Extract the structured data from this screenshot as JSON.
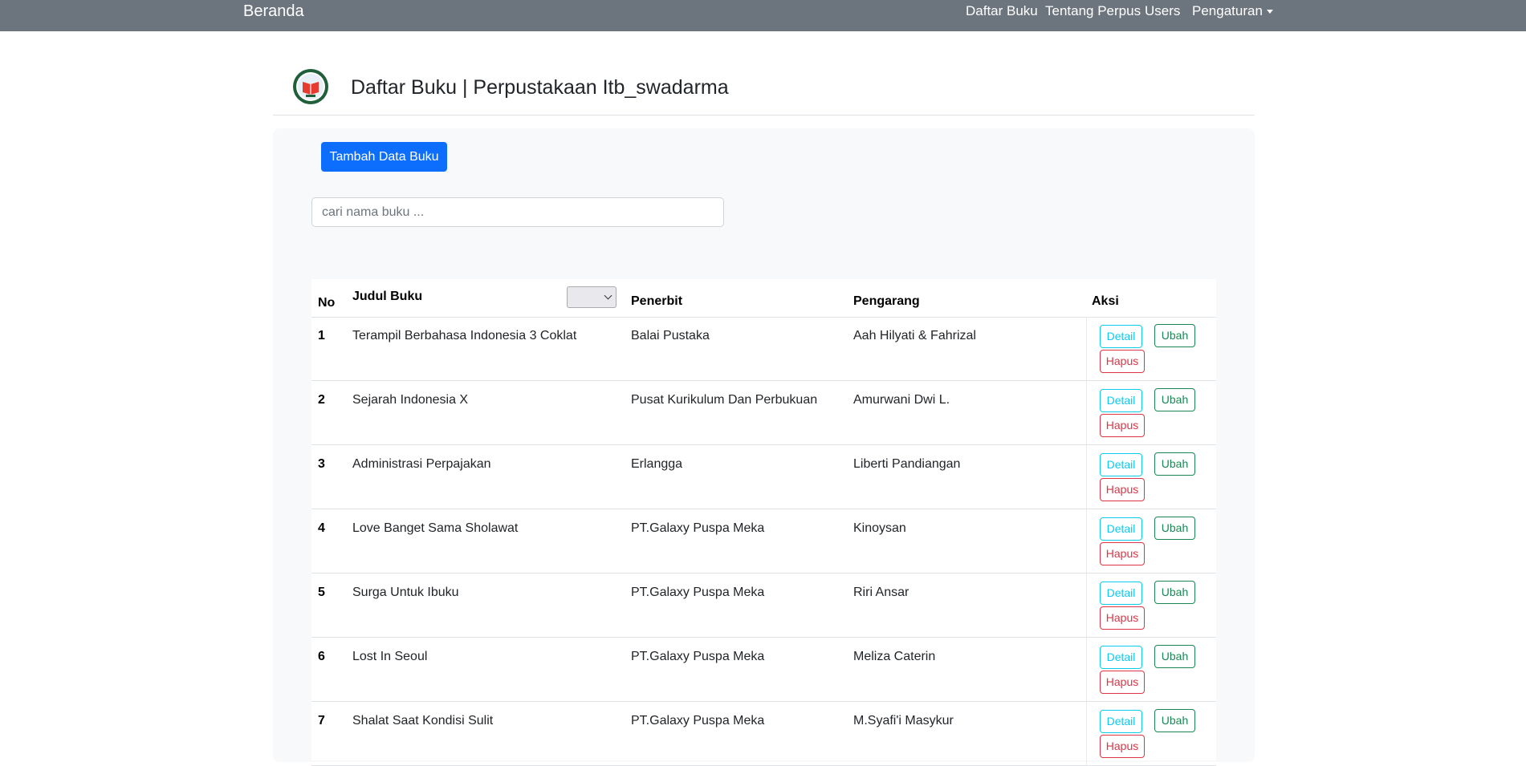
{
  "navbar": {
    "brand": "Beranda",
    "links": [
      "Daftar Buku",
      "Tentang Perpus",
      "Users"
    ],
    "dropdown_label": "Pengaturan"
  },
  "header": {
    "title": "Daftar Buku | Perpustakaan Itb_swadarma",
    "logo_icon": "itb-library-logo-icon"
  },
  "actions": {
    "add_button": "Tambah Data Buku"
  },
  "search": {
    "placeholder": "cari nama buku ...",
    "value": ""
  },
  "table": {
    "headers": {
      "no": "No",
      "title": "Judul Buku",
      "publisher": "Penerbit",
      "author": "Pengarang",
      "actions": "Aksi"
    },
    "sort_select_value": "",
    "row_buttons": {
      "detail": "Detail",
      "edit": "Ubah",
      "delete": "Hapus"
    },
    "rows": [
      {
        "no": "1",
        "title": "Terampil Berbahasa Indonesia 3 Coklat",
        "publisher": "Balai Pustaka",
        "author": "Aah Hilyati & Fahrizal"
      },
      {
        "no": "2",
        "title": "Sejarah Indonesia X",
        "publisher": "Pusat Kurikulum Dan Perbukuan",
        "author": "Amurwani Dwi L."
      },
      {
        "no": "3",
        "title": "Administrasi Perpajakan",
        "publisher": "Erlangga",
        "author": "Liberti Pandiangan"
      },
      {
        "no": "4",
        "title": "Love Banget Sama Sholawat",
        "publisher": "PT.Galaxy Puspa Meka",
        "author": "Kinoysan"
      },
      {
        "no": "5",
        "title": "Surga Untuk Ibuku",
        "publisher": "PT.Galaxy Puspa Meka",
        "author": "Riri Ansar"
      },
      {
        "no": "6",
        "title": "Lost In Seoul",
        "publisher": "PT.Galaxy Puspa Meka",
        "author": "Meliza Caterin"
      },
      {
        "no": "7",
        "title": "Shalat Saat Kondisi Sulit",
        "publisher": "PT.Galaxy Puspa Meka",
        "author": "M.Syafi'i Masykur"
      }
    ]
  },
  "colors": {
    "navbar": "#6c757d",
    "primary": "#0d6efd",
    "info": "#0dcaf0",
    "success": "#198754",
    "danger": "#dc3545"
  }
}
